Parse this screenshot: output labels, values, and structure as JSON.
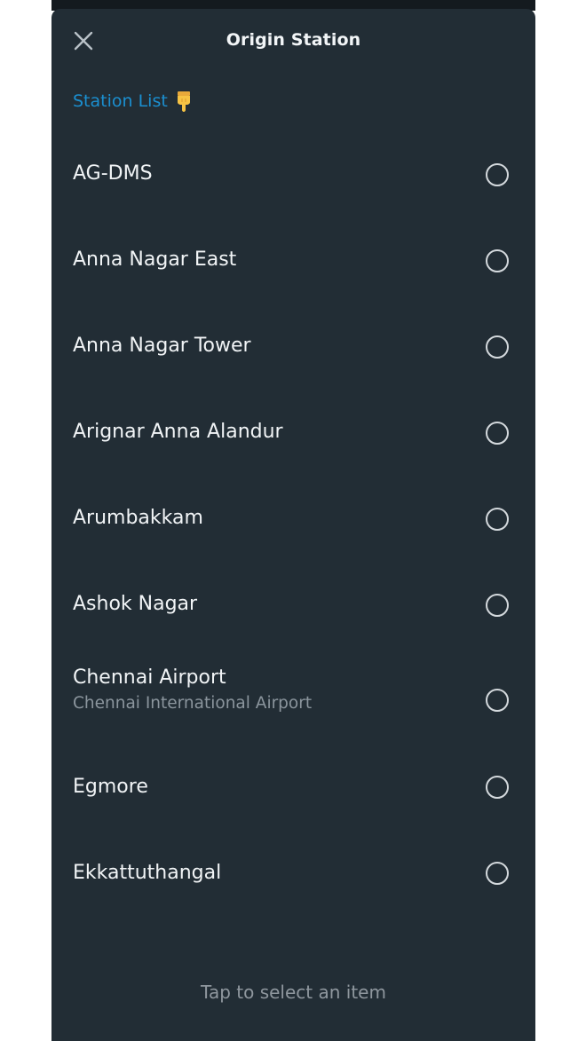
{
  "header": {
    "title": "Origin Station",
    "close_icon": "close-icon"
  },
  "section": {
    "label": "Station List",
    "icon": "pointing-down-icon",
    "color": "#1b8fd0"
  },
  "stations": [
    {
      "name": "AG-DMS",
      "subtitle": "",
      "selected": false
    },
    {
      "name": "Anna Nagar East",
      "subtitle": "",
      "selected": false
    },
    {
      "name": "Anna Nagar Tower",
      "subtitle": "",
      "selected": false
    },
    {
      "name": "Arignar Anna Alandur",
      "subtitle": "",
      "selected": false
    },
    {
      "name": "Arumbakkam",
      "subtitle": "",
      "selected": false
    },
    {
      "name": "Ashok Nagar",
      "subtitle": "",
      "selected": false
    },
    {
      "name": "Chennai Airport",
      "subtitle": "Chennai International Airport",
      "selected": false
    },
    {
      "name": "Egmore",
      "subtitle": "",
      "selected": false
    },
    {
      "name": "Ekkattuthangal",
      "subtitle": "",
      "selected": false
    }
  ],
  "footer": {
    "hint": "Tap to select an item"
  },
  "colors": {
    "sheet_background": "#222d35",
    "text_primary": "#f1f4f6",
    "text_secondary": "#8b959d"
  }
}
